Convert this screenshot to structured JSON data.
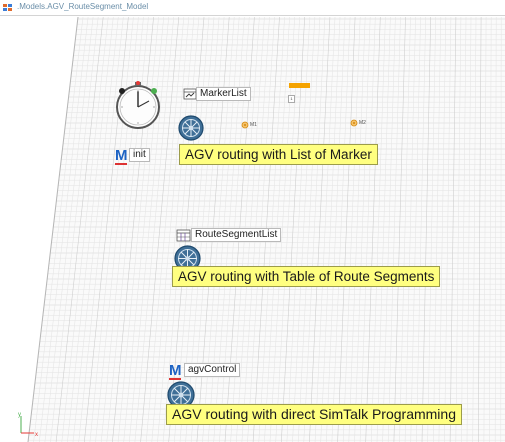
{
  "window": {
    "title": ".Models.AGV_RouteSegment_Model",
    "icon": "model-frame-icon"
  },
  "objects": {
    "event_controller": {
      "icon": "event-controller-clock-icon"
    },
    "marker_list": {
      "label": "MarkerList",
      "icon": "table-icon"
    },
    "route_segment_list": {
      "label": "RouteSegmentList",
      "icon": "table-icon"
    },
    "init_method": {
      "label": "init",
      "icon": "method-icon",
      "glyph": "M"
    },
    "agv_control_method": {
      "label": "agvControl",
      "icon": "method-icon",
      "glyph": "M"
    },
    "markers": [
      {
        "label": "M1"
      },
      {
        "label": "M2"
      }
    ],
    "small_tag": "1"
  },
  "comments": {
    "list_of_marker": "AGV routing with List of Marker",
    "table_of_route_segments": "AGV routing with Table of Route Segments",
    "direct_simtalk": "AGV routing with direct SimTalk Programming"
  },
  "axes": {
    "x": "x",
    "y": "y"
  },
  "colors": {
    "comment_bg": "#ffff80",
    "grid_minor": "#e6e6e6",
    "grid_major": "#cfcfcf",
    "method_blue": "#1d63c4",
    "accent_orange": "#f5a300"
  }
}
